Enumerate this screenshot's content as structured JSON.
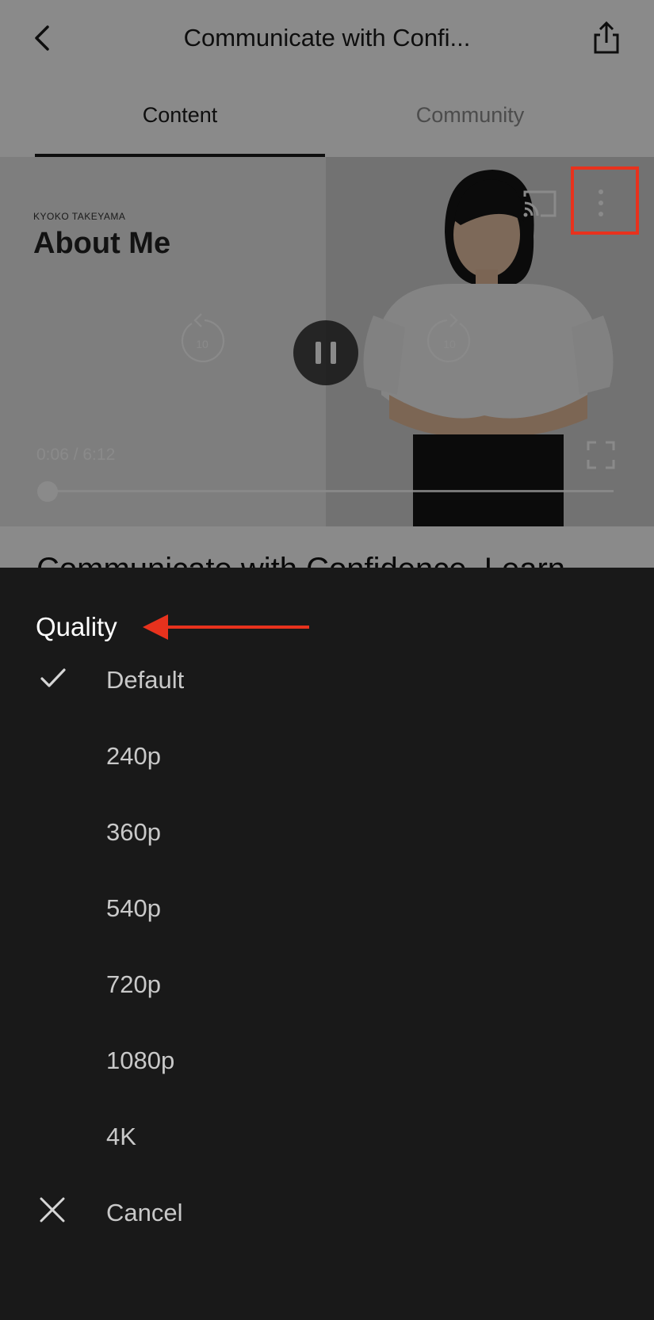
{
  "header": {
    "title": "Communicate with Confi...",
    "back_icon": "chevron-left-icon",
    "share_icon": "share-icon"
  },
  "tabs": [
    {
      "label": "Content",
      "active": true
    },
    {
      "label": "Community",
      "active": false
    }
  ],
  "video": {
    "kicker": "KYOKO TAKEYAMA",
    "slide_title": "About Me",
    "rewind_label": "10",
    "forward_label": "10",
    "timecode": "0:06 / 6:12",
    "progress_fraction": 0.016,
    "state": "playing"
  },
  "page": {
    "course_title": "Communicate with Confidence, Learn"
  },
  "sheet": {
    "title": "Quality",
    "options": [
      {
        "label": "Default",
        "selected": true
      },
      {
        "label": "240p",
        "selected": false
      },
      {
        "label": "360p",
        "selected": false
      },
      {
        "label": "540p",
        "selected": false
      },
      {
        "label": "720p",
        "selected": false
      },
      {
        "label": "1080p",
        "selected": false
      },
      {
        "label": "4K",
        "selected": false
      }
    ],
    "cancel_label": "Cancel"
  },
  "colors": {
    "annotation": "#e8321d",
    "sheet_bg": "#191919"
  }
}
